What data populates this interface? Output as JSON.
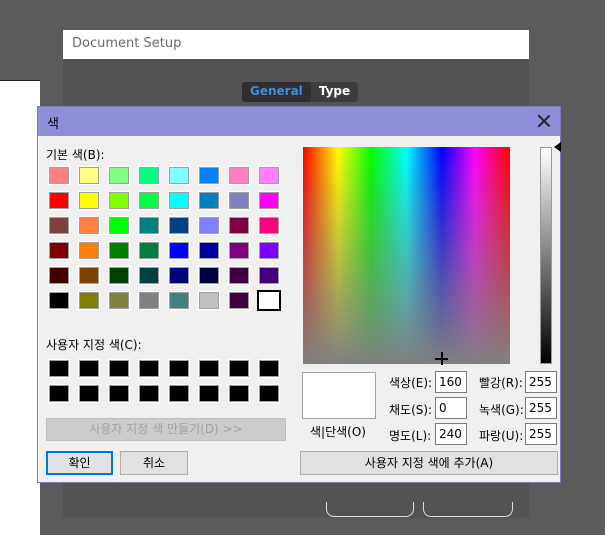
{
  "background_window": {
    "title": "Document Setup",
    "tabs": [
      {
        "label": "General",
        "active": true
      },
      {
        "label": "Type",
        "active": false
      }
    ]
  },
  "color_dialog": {
    "title": "색",
    "basic_colors_label": "기본 색(B):",
    "basic_colors": [
      [
        "#ff8080",
        "#ffff80",
        "#80ff80",
        "#00ff80",
        "#80ffff",
        "#0080ff",
        "#ff80c0",
        "#ff80ff"
      ],
      [
        "#ff0000",
        "#ffff00",
        "#80ff00",
        "#00ff40",
        "#00ffff",
        "#0080c0",
        "#8080c0",
        "#ff00ff"
      ],
      [
        "#804040",
        "#ff8040",
        "#00ff00",
        "#008080",
        "#004080",
        "#8080ff",
        "#800040",
        "#ff0080"
      ],
      [
        "#800000",
        "#ff8000",
        "#008000",
        "#008040",
        "#0000ff",
        "#0000a0",
        "#800080",
        "#8000ff"
      ],
      [
        "#400000",
        "#804000",
        "#004000",
        "#004040",
        "#000080",
        "#000040",
        "#400040",
        "#400080"
      ],
      [
        "#000000",
        "#808000",
        "#808040",
        "#808080",
        "#408080",
        "#c0c0c0",
        "#400040",
        "#ffffff"
      ]
    ],
    "selected_basic_color": "#ffffff",
    "custom_colors_label": "사용자 지정 색(C):",
    "custom_colors": [
      "#000000",
      "#000000",
      "#000000",
      "#000000",
      "#000000",
      "#000000",
      "#000000",
      "#000000",
      "#000000",
      "#000000",
      "#000000",
      "#000000",
      "#000000",
      "#000000",
      "#000000",
      "#000000"
    ],
    "define_custom_button": "사용자 지정 색 만들기(D) >>",
    "ok_button": "확인",
    "cancel_button": "취소",
    "preview_label": "색|단색(O)",
    "hue_label": "색상(E):",
    "hue_value": "160",
    "sat_label": "채도(S):",
    "sat_value": "0",
    "lum_label": "명도(L):",
    "lum_value": "240",
    "red_label": "빨강(R):",
    "red_value": "255",
    "green_label": "녹색(G):",
    "green_value": "255",
    "blue_label": "파랑(U):",
    "blue_value": "255",
    "add_custom_button": "사용자 지정 색에 추가(A)",
    "preview_color": "#ffffff",
    "title_bar_color": "#8e8fd8"
  }
}
